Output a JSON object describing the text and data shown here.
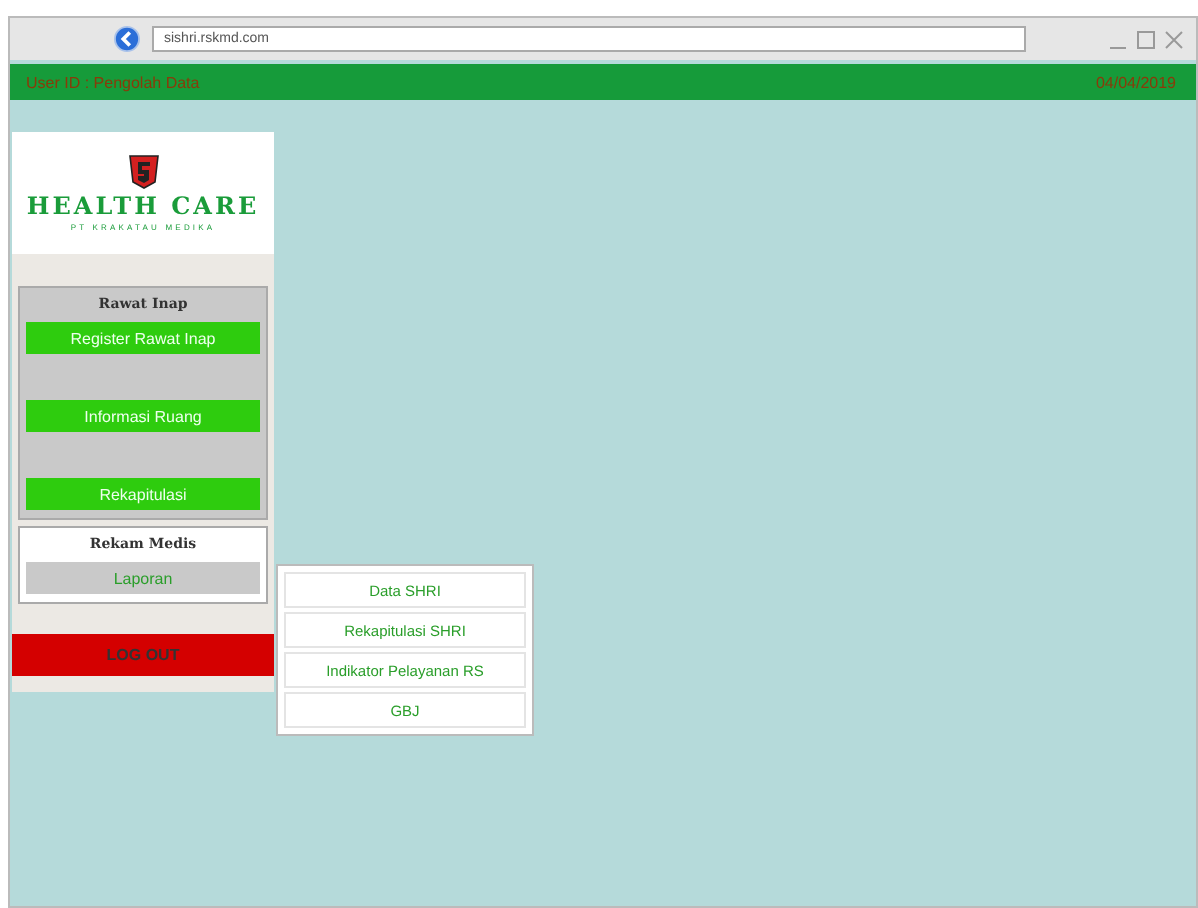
{
  "browser": {
    "url": "sishri.rskmd.com"
  },
  "header": {
    "user": "User  ID : Pengolah Data",
    "date": "04/04/2019"
  },
  "logo": {
    "title": "HEALTH CARE",
    "subtitle": "PT KRAKATAU MEDIKA"
  },
  "sections": [
    {
      "title": "Rawat Inap",
      "kind": "grey",
      "items": [
        {
          "label": "Register Rawat Inap",
          "selected": false
        },
        {
          "label": "Informasi Ruang",
          "selected": false
        },
        {
          "label": "Rekapitulasi",
          "selected": false
        }
      ]
    },
    {
      "title": "Rekam Medis",
      "kind": "white",
      "items": [
        {
          "label": "Laporan",
          "selected": true
        }
      ]
    }
  ],
  "logout": "LOG OUT",
  "submenu": [
    "Data SHRI",
    "Rekapitulasi SHRI",
    "Indikator Pelayanan RS",
    "GBJ"
  ]
}
